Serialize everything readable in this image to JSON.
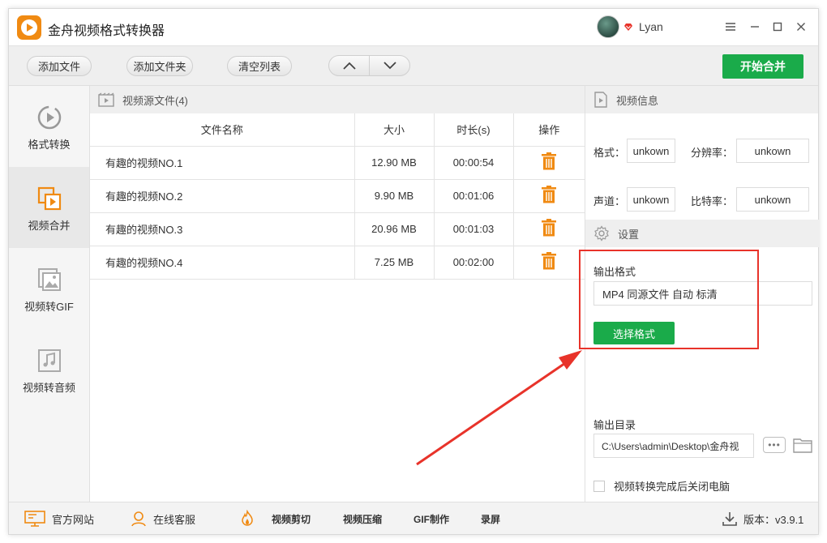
{
  "app": {
    "title": "金舟视频格式转换器"
  },
  "user": {
    "name": "Lyan"
  },
  "toolbar": {
    "add_file": "添加文件",
    "add_folder": "添加文件夹",
    "clear_list": "清空列表",
    "start_merge": "开始合并"
  },
  "sidebar": {
    "items": [
      {
        "label": "格式转换",
        "icon": "format-convert-icon"
      },
      {
        "label": "视频合并",
        "icon": "video-merge-icon"
      },
      {
        "label": "视频转GIF",
        "icon": "image-icon"
      },
      {
        "label": "视频转音频",
        "icon": "music-icon"
      }
    ]
  },
  "filelist": {
    "header": "视频源文件(4)",
    "columns": [
      "文件名称",
      "大小",
      "时长(s)",
      "操作"
    ],
    "rows": [
      {
        "name": "有趣的视频NO.1",
        "size": "12.90 MB",
        "duration": "00:00:54"
      },
      {
        "name": "有趣的视频NO.2",
        "size": "9.90 MB",
        "duration": "00:01:06"
      },
      {
        "name": "有趣的视频NO.3",
        "size": "20.96 MB",
        "duration": "00:01:03"
      },
      {
        "name": "有趣的视频NO.4",
        "size": "7.25 MB",
        "duration": "00:02:00"
      }
    ]
  },
  "video_info": {
    "header": "视频信息",
    "format_label": "格式：",
    "format_value": "unkown",
    "resolution_label": "分辨率：",
    "resolution_value": "unkown",
    "channel_label": "声道：",
    "channel_value": "unkown",
    "bitrate_label": "比特率：",
    "bitrate_value": "unkown"
  },
  "settings": {
    "header": "设置",
    "output_format_label": "输出格式",
    "output_format_value": "MP4  同源文件  自动  标清",
    "select_format_button": "选择格式",
    "output_dir_label": "输出目录",
    "output_dir_value": "C:\\Users\\admin\\Desktop\\金舟视",
    "shutdown_label": "视频转换完成后关闭电脑"
  },
  "footer": {
    "official_site": "官方网站",
    "online_service": "在线客服",
    "video_cut": "视频剪切",
    "video_compress": "视频压缩",
    "gif_make": "GIF制作",
    "screen_record": "录屏",
    "version": "版本：v3.9.1"
  },
  "colors": {
    "accent_green": "#1aab4a",
    "accent_orange": "#f08a12",
    "annotation_red": "#e8332a"
  }
}
